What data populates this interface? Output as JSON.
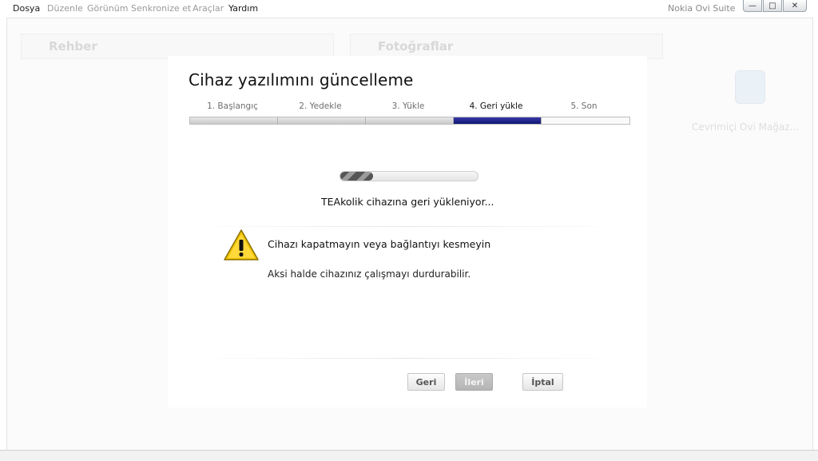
{
  "menu": {
    "items": [
      {
        "label": "Dosya",
        "active": true
      },
      {
        "label": "Düzenle",
        "active": false
      },
      {
        "label": "Görünüm",
        "active": false
      },
      {
        "label": "Senkronize et",
        "active": false
      },
      {
        "label": "Araçlar",
        "active": false
      },
      {
        "label": "Yardım",
        "active": true
      }
    ],
    "app_title": "Nokia Ovi Suite"
  },
  "window_controls": {
    "minimize": "—",
    "maximize": "□",
    "close": "✕"
  },
  "background": {
    "panel_left": "Rehber",
    "panel_right": "Fotoğraflar",
    "store": "Cevrimiçi Ovi Mağaz..."
  },
  "dialog": {
    "title": "Cihaz yazılımını güncelleme",
    "steps": [
      "1. Başlangıç",
      "2. Yedekle",
      "3. Yükle",
      "4. Geri yükle",
      "5. Son"
    ],
    "current_step": 4,
    "progress_fraction": 0.24,
    "status": "TEAkolik cihazına geri yükleniyor...",
    "warning_title": "Cihazı kapatmayın veya bağlantıyı kesmeyin",
    "warning_text": "Aksi halde cihazınız çalışmayı durdurabilir.",
    "buttons": {
      "back": "Geri",
      "next": "İleri",
      "cancel": "İptal"
    }
  },
  "colors": {
    "step_active": "#1a1f80",
    "warning_yellow": "#f2c500"
  }
}
